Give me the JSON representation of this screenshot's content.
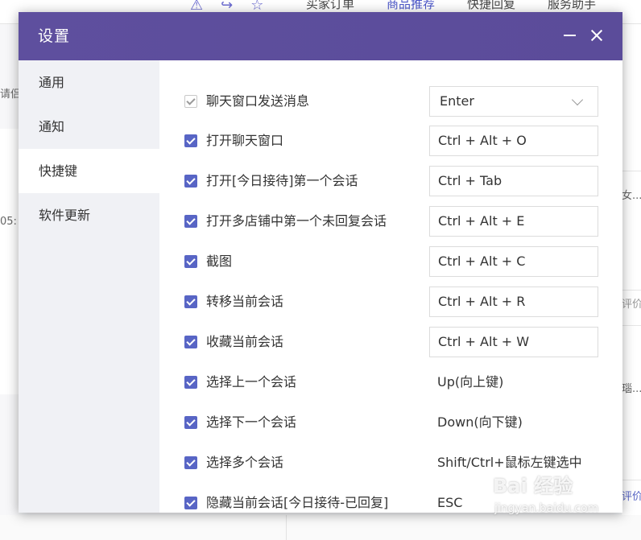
{
  "background": {
    "tabs": [
      "买家订单",
      "商品推荐",
      "快捷回复",
      "服务助手"
    ],
    "active_tab": "商品推荐",
    "left_snippets": [
      "请侣",
      "05:"
    ],
    "right_snippets": [
      "女...",
      "评价",
      "瑙...",
      "评价"
    ]
  },
  "dialog": {
    "title": "设置",
    "sidebar": [
      {
        "label": "通用"
      },
      {
        "label": "通知"
      },
      {
        "label": "快捷键"
      },
      {
        "label": "软件更新"
      }
    ],
    "active_sidebar": "快捷键",
    "shortcuts": [
      {
        "label": "聊天窗口发送消息",
        "key": "Enter",
        "kind": "select",
        "checked": true,
        "disabled": true
      },
      {
        "label": "打开聊天窗口",
        "key": "Ctrl + Alt + O",
        "kind": "input",
        "checked": true
      },
      {
        "label": "打开[今日接待]第一个会话",
        "key": "Ctrl + Tab",
        "kind": "input",
        "checked": true
      },
      {
        "label": "打开多店铺中第一个未回复会话",
        "key": "Ctrl + Alt + E",
        "kind": "input",
        "checked": true
      },
      {
        "label": "截图",
        "key": "Ctrl + Alt + C",
        "kind": "input",
        "checked": true
      },
      {
        "label": "转移当前会话",
        "key": "Ctrl + Alt + R",
        "kind": "input",
        "checked": true
      },
      {
        "label": "收藏当前会话",
        "key": "Ctrl + Alt + W",
        "kind": "input",
        "checked": true
      },
      {
        "label": "选择上一个会话",
        "key": "Up(向上键)",
        "kind": "text",
        "checked": true
      },
      {
        "label": "选择下一个会话",
        "key": "Down(向下键)",
        "kind": "text",
        "checked": true
      },
      {
        "label": "选择多个会话",
        "key": "Shift/Ctrl+鼠标左键选中",
        "kind": "text",
        "checked": true
      },
      {
        "label": "隐藏当前会话[今日接待-已回复]",
        "key": "ESC",
        "kind": "text",
        "checked": true
      }
    ]
  },
  "watermark": {
    "logo": "Bai 经验",
    "url": "jingyan.baidu.com"
  },
  "colors": {
    "titlebar": "#5b4c9a",
    "checkbox": "#5865c5",
    "sidebar_bg": "#f0f1f5"
  }
}
